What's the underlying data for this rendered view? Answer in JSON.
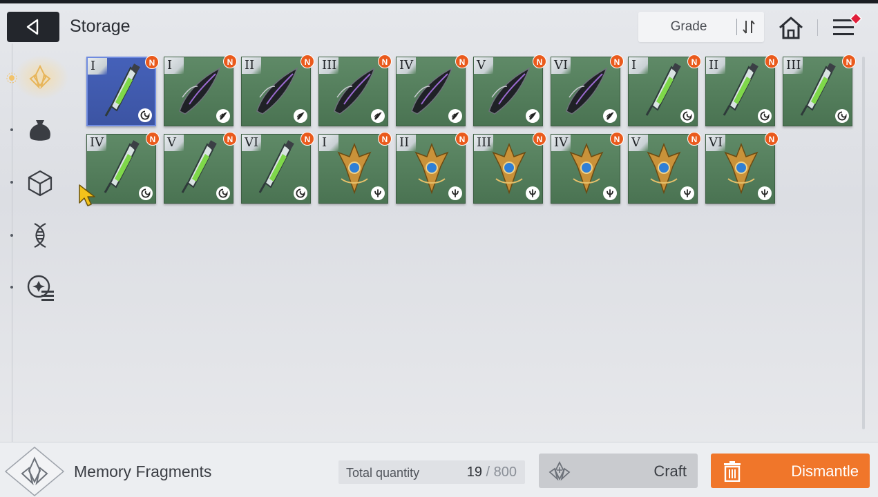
{
  "header": {
    "title": "Storage",
    "sort_label": "Grade",
    "icons": {
      "back": "back-arrow-icon",
      "sort": "sort-toggle-icon",
      "home": "home-icon",
      "menu": "menu-icon"
    },
    "menu_has_alert": true
  },
  "sidebar": {
    "items": [
      {
        "name": "memory-fragments",
        "icon": "crystal-icon",
        "active": true
      },
      {
        "name": "materials",
        "icon": "pouch-icon",
        "active": false
      },
      {
        "name": "cubes",
        "icon": "cube-icon",
        "active": false
      },
      {
        "name": "genes",
        "icon": "dna-icon",
        "active": false
      },
      {
        "name": "records",
        "icon": "record-list-icon",
        "active": false
      }
    ]
  },
  "items": [
    {
      "tier": "I",
      "badge": "N",
      "set": "green-vial",
      "type": "swirl",
      "selected": true
    },
    {
      "tier": "I",
      "badge": "N",
      "set": "dark-feather",
      "type": "wing",
      "selected": false
    },
    {
      "tier": "II",
      "badge": "N",
      "set": "dark-feather",
      "type": "wing",
      "selected": false
    },
    {
      "tier": "III",
      "badge": "N",
      "set": "dark-feather",
      "type": "wing",
      "selected": false
    },
    {
      "tier": "IV",
      "badge": "N",
      "set": "dark-feather",
      "type": "wing",
      "selected": false
    },
    {
      "tier": "V",
      "badge": "N",
      "set": "dark-feather",
      "type": "wing",
      "selected": false
    },
    {
      "tier": "VI",
      "badge": "N",
      "set": "dark-feather",
      "type": "wing",
      "selected": false
    },
    {
      "tier": "I",
      "badge": "N",
      "set": "green-vial",
      "type": "swirl",
      "selected": false
    },
    {
      "tier": "II",
      "badge": "N",
      "set": "green-vial",
      "type": "swirl",
      "selected": false
    },
    {
      "tier": "III",
      "badge": "N",
      "set": "green-vial",
      "type": "swirl",
      "selected": false
    },
    {
      "tier": "IV",
      "badge": "N",
      "set": "green-vial",
      "type": "swirl",
      "selected": false
    },
    {
      "tier": "V",
      "badge": "N",
      "set": "green-vial",
      "type": "swirl",
      "selected": false
    },
    {
      "tier": "VI",
      "badge": "N",
      "set": "green-vial",
      "type": "swirl",
      "selected": false
    },
    {
      "tier": "I",
      "badge": "N",
      "set": "gold-trident",
      "type": "trident",
      "selected": false
    },
    {
      "tier": "II",
      "badge": "N",
      "set": "gold-trident",
      "type": "trident",
      "selected": false
    },
    {
      "tier": "III",
      "badge": "N",
      "set": "gold-trident",
      "type": "trident",
      "selected": false
    },
    {
      "tier": "IV",
      "badge": "N",
      "set": "gold-trident",
      "type": "trident",
      "selected": false
    },
    {
      "tier": "V",
      "badge": "N",
      "set": "gold-trident",
      "type": "trident",
      "selected": false
    },
    {
      "tier": "VI",
      "badge": "N",
      "set": "gold-trident",
      "type": "trident",
      "selected": false
    }
  ],
  "footer": {
    "category_label": "Memory Fragments",
    "total_label": "Total quantity",
    "total_count": "19",
    "total_sep": " / ",
    "total_max": "800",
    "craft_label": "Craft",
    "dismantle_label": "Dismantle"
  },
  "colors": {
    "card_green": "#4f7757",
    "card_selected": "#4561b9",
    "badge": "#ea5a1c",
    "dismantle": "#f0762a",
    "craft": "#c9cbcf"
  }
}
